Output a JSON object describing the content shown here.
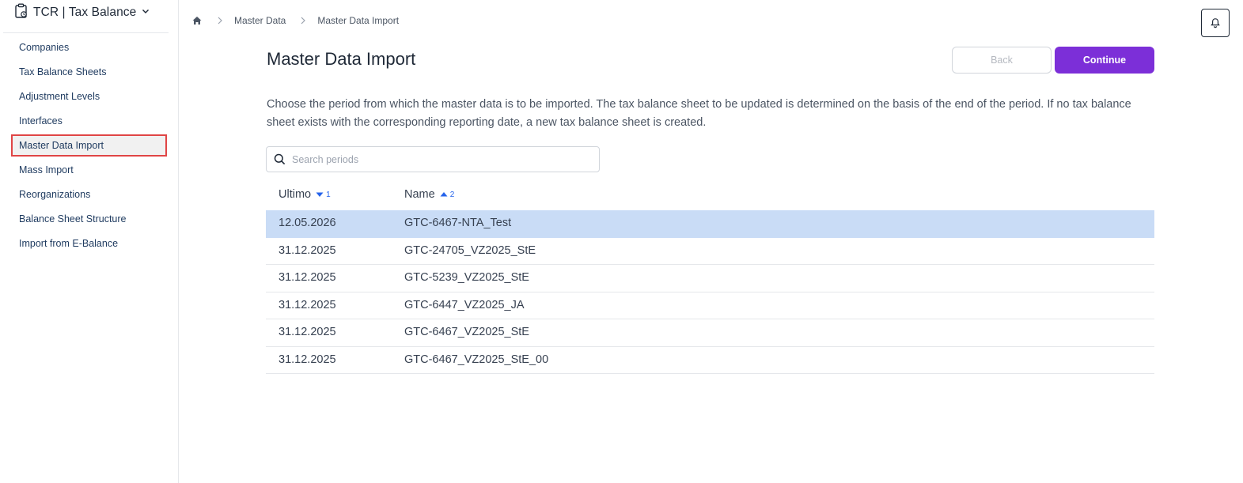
{
  "app": {
    "title": "TCR | Tax Balance"
  },
  "sidebar": {
    "items": [
      {
        "label": "Companies"
      },
      {
        "label": "Tax Balance Sheets"
      },
      {
        "label": "Adjustment Levels"
      },
      {
        "label": "Interfaces"
      },
      {
        "label": "Master Data Import",
        "active": true
      },
      {
        "label": "Mass Import"
      },
      {
        "label": "Reorganizations"
      },
      {
        "label": "Balance Sheet Structure"
      },
      {
        "label": "Import from E-Balance"
      }
    ]
  },
  "breadcrumb": {
    "items": [
      "Master Data",
      "Master Data Import"
    ]
  },
  "page": {
    "title": "Master Data Import",
    "back_label": "Back",
    "continue_label": "Continue",
    "description": "Choose the period from which the master data is to be imported. The tax balance sheet to be updated is determined on the basis of the end of the period. If no tax balance sheet exists with the corresponding reporting date, a new tax balance sheet is created."
  },
  "search": {
    "placeholder": "Search periods",
    "value": ""
  },
  "table": {
    "columns": [
      {
        "label": "Ultimo",
        "sort": "descending",
        "sort_order": "1"
      },
      {
        "label": "Name",
        "sort": "ascending",
        "sort_order": "2"
      }
    ],
    "rows": [
      {
        "ultimo": "12.05.2026",
        "name": "GTC-6467-NTA_Test",
        "selected": true
      },
      {
        "ultimo": "31.12.2025",
        "name": "GTC-24705_VZ2025_StE"
      },
      {
        "ultimo": "31.12.2025",
        "name": "GTC-5239_VZ2025_StE"
      },
      {
        "ultimo": "31.12.2025",
        "name": "GTC-6447_VZ2025_JA"
      },
      {
        "ultimo": "31.12.2025",
        "name": "GTC-6467_VZ2025_StE"
      },
      {
        "ultimo": "31.12.2025",
        "name": "GTC-6467_VZ2025_StE_00"
      }
    ]
  },
  "colors": {
    "accent": "#7c2fd8",
    "selected_row": "#c9dcf6",
    "sort_indicator": "#2563eb",
    "active_nav_outline": "#e04545"
  },
  "icons": [
    "clipboard-icon",
    "chevron-down-icon",
    "home-icon",
    "chevron-right-icon",
    "bell-icon",
    "search-icon",
    "sort-desc-icon",
    "sort-asc-icon"
  ]
}
